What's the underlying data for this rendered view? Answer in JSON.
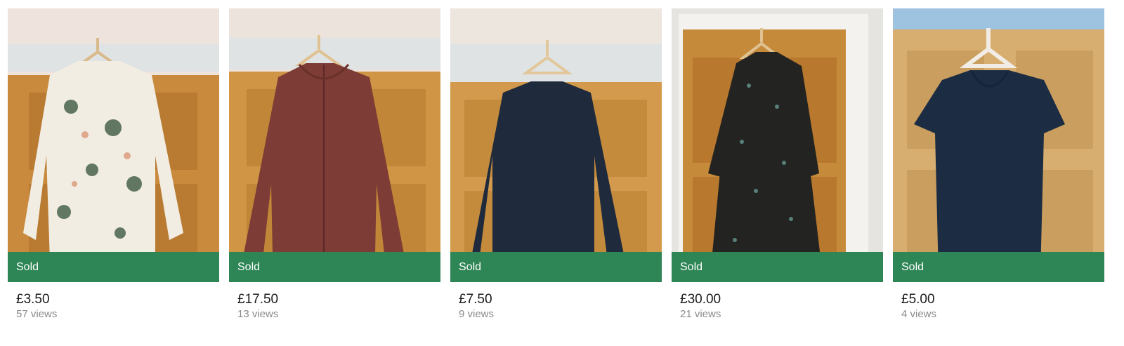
{
  "colors": {
    "sold_banner": "#2e8555",
    "price_text": "#1b1b1b",
    "views_text": "#8a8a8a"
  },
  "listings": [
    {
      "item": "floral-print-shirt",
      "status": "Sold",
      "price": "£3.50",
      "views": "57 views"
    },
    {
      "item": "maroon-zip-hoodie",
      "status": "Sold",
      "price": "£17.50",
      "views": "13 views"
    },
    {
      "item": "navy-long-sleeve-top",
      "status": "Sold",
      "price": "£7.50",
      "views": "9 views"
    },
    {
      "item": "black-floral-dress",
      "status": "Sold",
      "price": "£30.00",
      "views": "21 views"
    },
    {
      "item": "navy-t-shirt",
      "status": "Sold",
      "price": "£5.00",
      "views": "4 views"
    }
  ]
}
